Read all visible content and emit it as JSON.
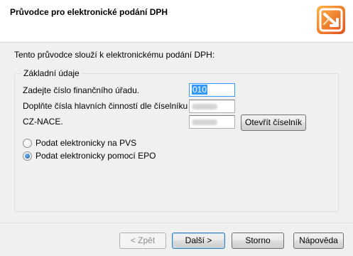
{
  "header": {
    "title": "Průvodce pro elektronické podání DPH"
  },
  "intro_text": "Tento průvodce slouží k elektronickému podání DPH:",
  "group": {
    "legend": "Základní údaje",
    "office_label": "Zadejte číslo finančního úřadu.",
    "office_value": "010",
    "activity_label_line1": "Doplňte čísla hlavních činností dle číselníku",
    "activity_label_line2": "CZ-NACE.",
    "open_codebook_label": "Otevřít číselník"
  },
  "options": {
    "pvs_label": "Podat elektronicky na PVS",
    "epo_label": "Podat elektronicky pomocí EPO",
    "selected": "epo"
  },
  "buttons": {
    "back_label": "< Zpět",
    "next_label": "Další >",
    "cancel_label": "Storno",
    "help_label": "Nápověda"
  },
  "colors": {
    "accent": "#3399ff",
    "dialog_bg": "#f0f0f0",
    "header_bg": "#ffffff"
  }
}
